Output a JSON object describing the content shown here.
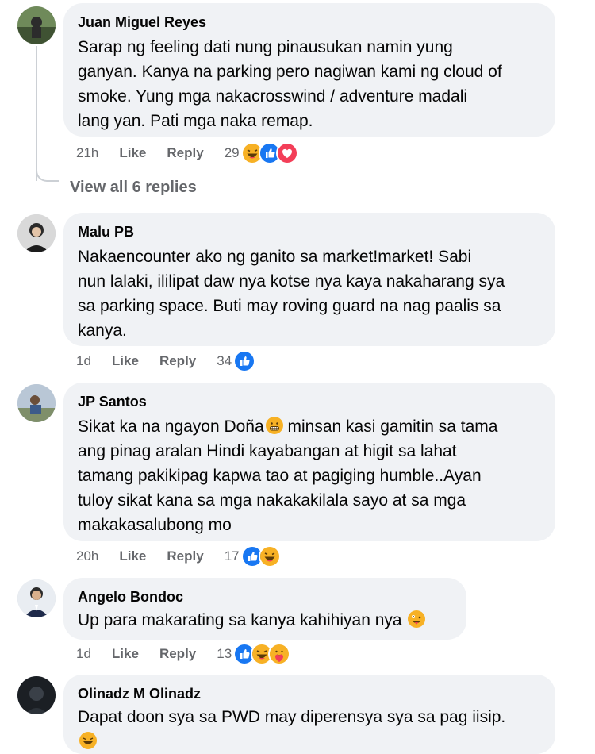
{
  "comments": [
    {
      "author": "Juan Miguel Reyes",
      "lines": [
        "Sarap ng feeling dati nung pinausukan namin yung",
        "ganyan. Kanya na parking pero nagiwan kami ng cloud of",
        "smoke. Yung mga nakacrosswind / adventure madali",
        "lang yan. Pati mga naka remap."
      ],
      "time": "21h",
      "like": "Like",
      "reply": "Reply",
      "reaction_count": "29",
      "reactions": [
        "haha",
        "like",
        "love"
      ]
    },
    {
      "author": "Malu PB",
      "lines": [
        "Nakaencounter ako ng ganito sa market!market! Sabi",
        "nun lalaki, ililipat daw nya kotse nya kaya nakaharang sya",
        "sa parking space. Buti may roving guard na nag paalis sa",
        "kanya."
      ],
      "time": "1d",
      "like": "Like",
      "reply": "Reply",
      "reaction_count": "34",
      "reactions": [
        "like"
      ]
    },
    {
      "author": "JP Santos",
      "lines": [
        "Sikat ka na ngayon Doña",
        "ang pinag aralan Hindi kayabangan at higit sa lahat",
        "tamang pakikipag kapwa tao at pagiging humble..Ayan",
        "tuloy sikat kana sa mga nakakakilala sayo at sa mga",
        "makakasalubong mo"
      ],
      "line1_suffix": " minsan kasi gamitin sa tama",
      "time": "20h",
      "like": "Like",
      "reply": "Reply",
      "reaction_count": "17",
      "reactions": [
        "like",
        "haha"
      ]
    },
    {
      "author": "Angelo Bondoc",
      "lines": [
        "Up para makarating sa kanya kahihiyan nya"
      ],
      "time": "1d",
      "like": "Like",
      "reply": "Reply",
      "reaction_count": "13",
      "reactions": [
        "like",
        "haha",
        "care"
      ]
    },
    {
      "author": "Olinadz M Olinadz",
      "lines": [
        "Dapat doon sya sa PWD may diperensya sya sa pag iisip."
      ]
    }
  ],
  "view_replies": "View all 6 replies",
  "colors": {
    "bubble": "#f0f2f5",
    "meta": "#65676b",
    "like_blue": "#1877f2",
    "love_red": "#f33e58",
    "haha_yellow": "#f7b125"
  }
}
